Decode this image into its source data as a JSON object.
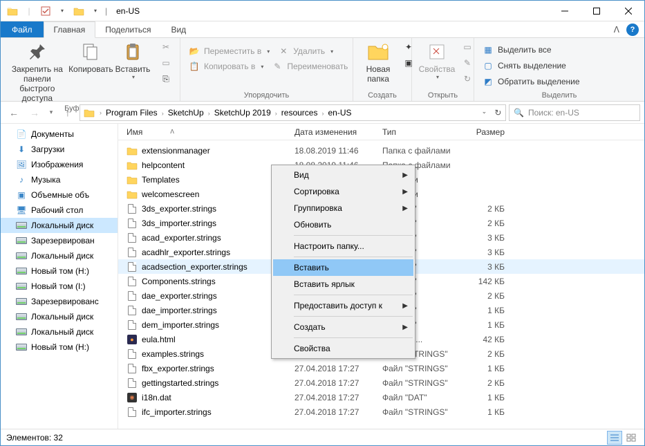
{
  "title": "en-US",
  "tabs": {
    "file": "Файл",
    "home": "Главная",
    "share": "Поделиться",
    "view": "Вид"
  },
  "ribbon": {
    "clipboard": {
      "label": "Буфер обмена",
      "pin": "Закрепить на панели\nбыстрого доступа",
      "copy": "Копировать",
      "paste": "Вставить"
    },
    "organize": {
      "label": "Упорядочить",
      "move": "Переместить в",
      "copyto": "Копировать в",
      "delete": "Удалить",
      "rename": "Переименовать"
    },
    "new": {
      "label": "Создать",
      "newfolder": "Новая\nпапка"
    },
    "open": {
      "label": "Открыть",
      "props": "Свойства"
    },
    "select": {
      "label": "Выделить",
      "all": "Выделить все",
      "none": "Снять выделение",
      "invert": "Обратить выделение"
    }
  },
  "breadcrumb": [
    "Program Files",
    "SketchUp",
    "SketchUp 2019",
    "resources",
    "en-US"
  ],
  "search_placeholder": "Поиск: en-US",
  "sidebar": [
    {
      "icon": "doc",
      "label": "Документы"
    },
    {
      "icon": "dl",
      "label": "Загрузки"
    },
    {
      "icon": "img",
      "label": "Изображения"
    },
    {
      "icon": "music",
      "label": "Музыка"
    },
    {
      "icon": "3d",
      "label": "Объемные объ"
    },
    {
      "icon": "desk",
      "label": "Рабочий стол"
    },
    {
      "icon": "disk",
      "label": "Локальный диск",
      "selected": true
    },
    {
      "icon": "disk",
      "label": "Зарезервирован"
    },
    {
      "icon": "disk",
      "label": "Локальный диск"
    },
    {
      "icon": "disk",
      "label": "Новый том (H:)"
    },
    {
      "icon": "disk",
      "label": "Новый том (I:)"
    },
    {
      "icon": "disk",
      "label": "Зарезервированс"
    },
    {
      "icon": "disk",
      "label": "Локальный диск"
    },
    {
      "icon": "disk",
      "label": "Локальный диск"
    },
    {
      "icon": "disk",
      "label": "Новый том (H:)"
    }
  ],
  "columns": {
    "name": "Имя",
    "date": "Дата изменения",
    "type": "Тип",
    "size": "Размер"
  },
  "files": [
    {
      "icon": "folder",
      "name": "extensionmanager",
      "date": "18.08.2019 11:46",
      "type": "Папка с файлами",
      "size": ""
    },
    {
      "icon": "folder",
      "name": "helpcontent",
      "date": "18.08.2019 11:46",
      "type": "Папка с файлами",
      "size": ""
    },
    {
      "icon": "folder",
      "name": "Templates",
      "date": "",
      "type": "файлами",
      "size": ""
    },
    {
      "icon": "folder",
      "name": "welcomescreen",
      "date": "",
      "type": "файлами",
      "size": ""
    },
    {
      "icon": "file",
      "name": "3ds_exporter.strings",
      "date": "",
      "type": "TRINGS\"",
      "size": "2 КБ"
    },
    {
      "icon": "file",
      "name": "3ds_importer.strings",
      "date": "",
      "type": "TRINGS\"",
      "size": "2 КБ"
    },
    {
      "icon": "file",
      "name": "acad_exporter.strings",
      "date": "",
      "type": "TRINGS\"",
      "size": "3 КБ"
    },
    {
      "icon": "file",
      "name": "acadhlr_exporter.strings",
      "date": "",
      "type": "TRINGS\"",
      "size": "3 КБ"
    },
    {
      "icon": "file",
      "name": "acadsection_exporter.strings",
      "date": "",
      "type": "TRINGS\"",
      "size": "3 КБ",
      "hover": true
    },
    {
      "icon": "file",
      "name": "Components.strings",
      "date": "",
      "type": "TRINGS\"",
      "size": "142 КБ"
    },
    {
      "icon": "file",
      "name": "dae_exporter.strings",
      "date": "",
      "type": "TRINGS\"",
      "size": "2 КБ"
    },
    {
      "icon": "file",
      "name": "dae_importer.strings",
      "date": "",
      "type": "TRINGS\"",
      "size": "1 КБ"
    },
    {
      "icon": "file",
      "name": "dem_importer.strings",
      "date": "",
      "type": "TRINGS\"",
      "size": "1 КБ"
    },
    {
      "icon": "ff",
      "name": "eula.html",
      "date": "",
      "type": "TML Doc...",
      "size": "42 КБ"
    },
    {
      "icon": "file",
      "name": "examples.strings",
      "date": "27.04.2018 17:27",
      "type": "Файл \"STRINGS\"",
      "size": "2 КБ"
    },
    {
      "icon": "file",
      "name": "fbx_exporter.strings",
      "date": "27.04.2018 17:27",
      "type": "Файл \"STRINGS\"",
      "size": "1 КБ"
    },
    {
      "icon": "file",
      "name": "gettingstarted.strings",
      "date": "27.04.2018 17:27",
      "type": "Файл \"STRINGS\"",
      "size": "2 КБ"
    },
    {
      "icon": "dat",
      "name": "i18n.dat",
      "date": "27.04.2018 17:27",
      "type": "Файл \"DAT\"",
      "size": "1 КБ"
    },
    {
      "icon": "file",
      "name": "ifc_importer.strings",
      "date": "27.04.2018 17:27",
      "type": "Файл \"STRINGS\"",
      "size": "1 КБ"
    }
  ],
  "context_menu": [
    {
      "label": "Вид",
      "sub": true
    },
    {
      "label": "Сортировка",
      "sub": true
    },
    {
      "label": "Группировка",
      "sub": true
    },
    {
      "label": "Обновить"
    },
    {
      "sep": true
    },
    {
      "label": "Настроить папку..."
    },
    {
      "sep": true
    },
    {
      "label": "Вставить",
      "hi": true
    },
    {
      "label": "Вставить ярлык"
    },
    {
      "sep": true
    },
    {
      "label": "Предоставить доступ к",
      "sub": true
    },
    {
      "sep": true
    },
    {
      "label": "Создать",
      "sub": true
    },
    {
      "sep": true
    },
    {
      "label": "Свойства"
    }
  ],
  "status": "Элементов: 32"
}
